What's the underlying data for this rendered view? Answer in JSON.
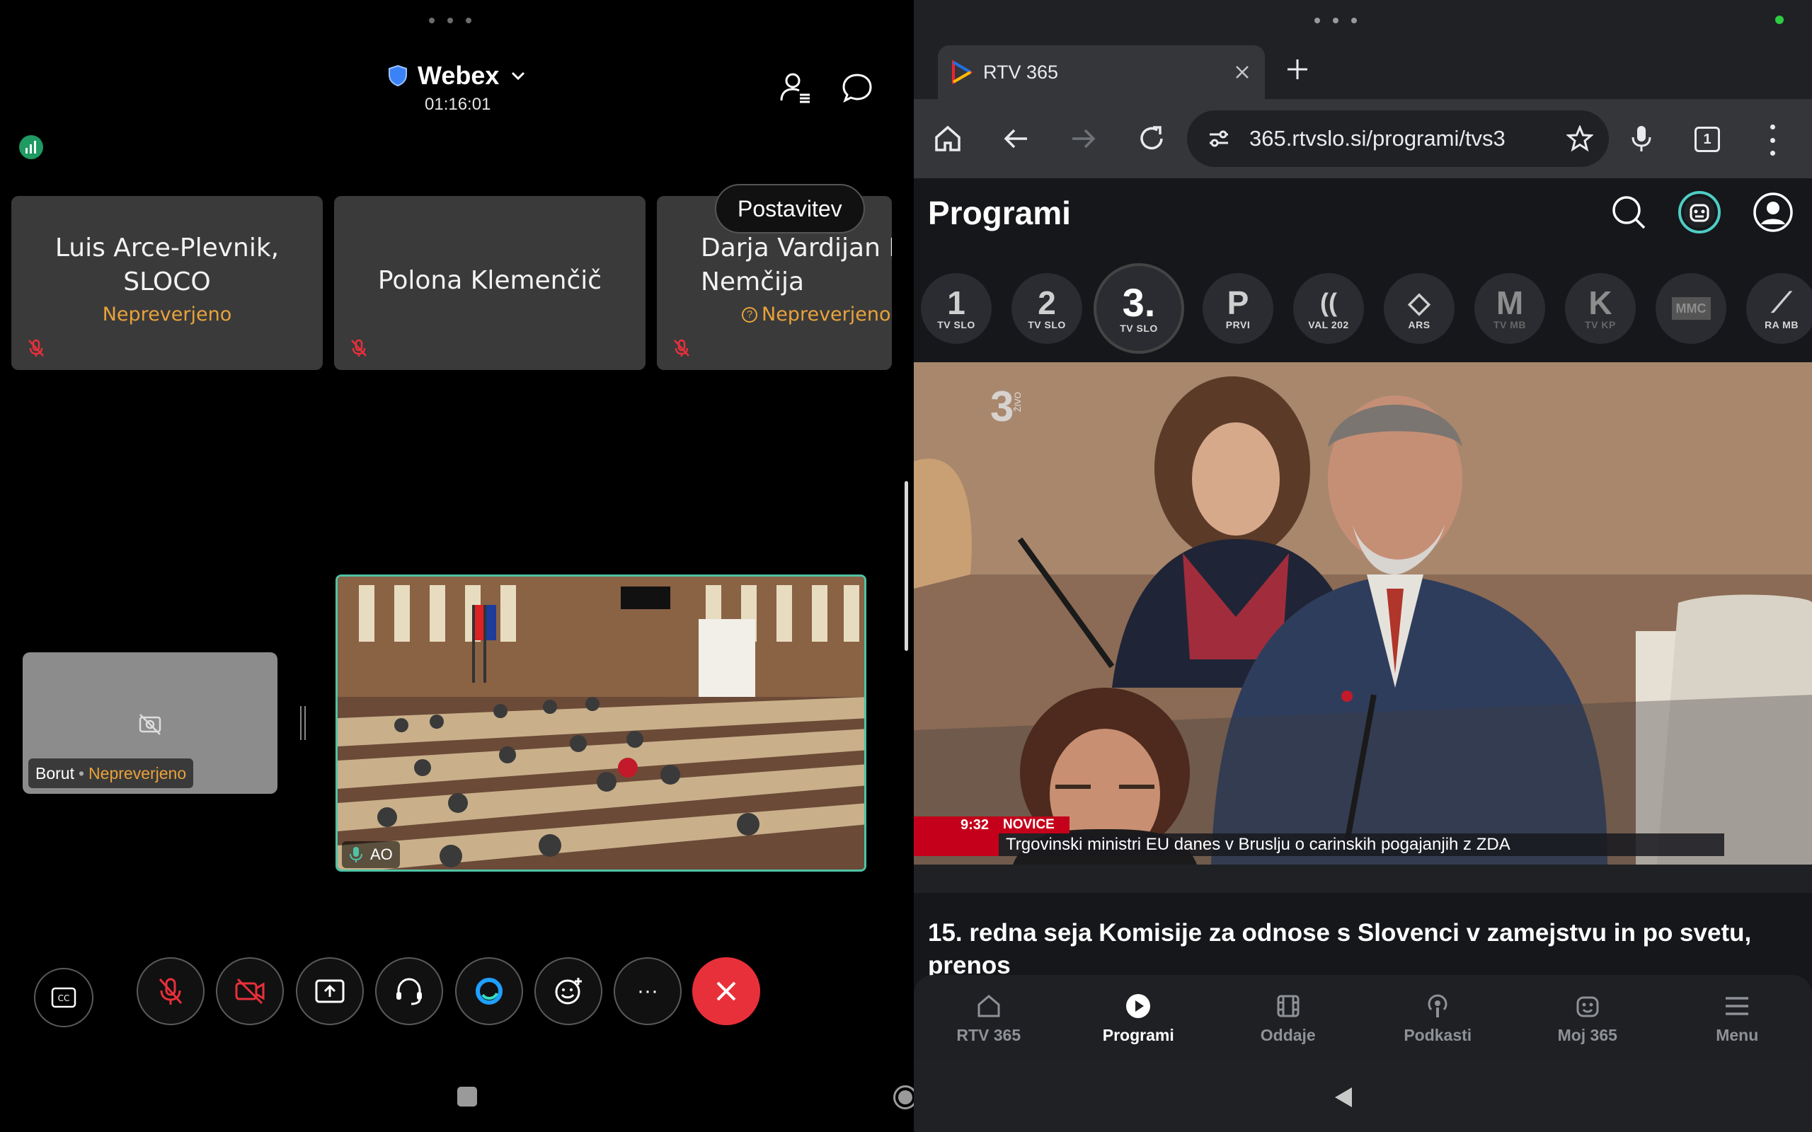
{
  "webex": {
    "app_name": "Webex",
    "timer": "01:16:01",
    "layout_tooltip": "Postavitev",
    "participants": [
      {
        "name": "Luis Arce-Plevnik, SLOCO",
        "status": "Nepreverjeno"
      },
      {
        "name": "Polona Klemenčič",
        "status": ""
      },
      {
        "name": "Darja Vardijan Bra Nemčija",
        "status": "Nepreverjeno"
      }
    ],
    "self_view": {
      "name": "Borut",
      "separator": "•",
      "status": "Nepreverjeno"
    },
    "active_speaker": {
      "label": "AO"
    },
    "controls": [
      "captions",
      "mute",
      "video-off",
      "share",
      "audio",
      "webex-ai",
      "reactions",
      "more",
      "leave"
    ],
    "more_label": "···"
  },
  "browser": {
    "tab_title": "RTV 365",
    "url": "365.rtvslo.si/programi/tvs3",
    "tab_count": "1",
    "page_title": "Programi",
    "channels": [
      {
        "big": "1",
        "small": "TV SLO"
      },
      {
        "big": "2",
        "small": "TV SLO"
      },
      {
        "big": "3.",
        "small": "TV SLO"
      },
      {
        "big": "P",
        "small": "PRVI"
      },
      {
        "big": "((",
        "small": "VAL 202"
      },
      {
        "big": "◇",
        "small": "ARS"
      },
      {
        "big": "M",
        "small": "TV MB"
      },
      {
        "big": "K",
        "small": "TV KP"
      },
      {
        "big": "MMC",
        "small": ""
      },
      {
        "big": "⟋",
        "small": "RA MB"
      }
    ],
    "video": {
      "channel_badge": "3",
      "live_badge": "ŽIVO",
      "ticker_time": "9:32",
      "ticker_tag": "NOVICE",
      "ticker_text": "Trgovinski ministri EU danes v Bruslju o carinskih pogajanjih z ZDA"
    },
    "program_title": "15. redna seja Komisije za odnose s Slovenci v zamejstvu in po svetu, prenos",
    "bottom_nav": [
      {
        "label": "RTV 365",
        "icon": "home-icon"
      },
      {
        "label": "Programi",
        "icon": "play-icon",
        "active": true
      },
      {
        "label": "Oddaje",
        "icon": "film-icon"
      },
      {
        "label": "Podkasti",
        "icon": "podcast-icon"
      },
      {
        "label": "Moj 365",
        "icon": "smiley-icon"
      },
      {
        "label": "Menu",
        "icon": "menu-icon"
      }
    ]
  },
  "colors": {
    "status_orange": "#e9a23b",
    "leave_red": "#e8303a",
    "speaker_border": "#4fc3a6",
    "tv_red": "#c4001a"
  }
}
